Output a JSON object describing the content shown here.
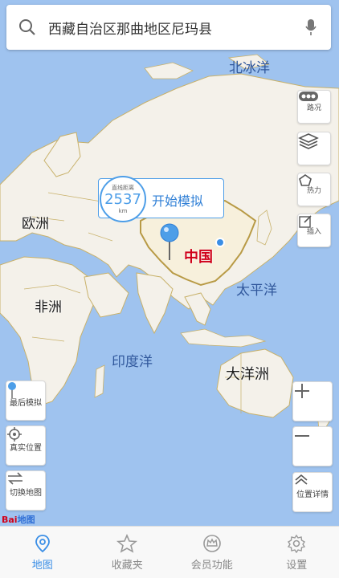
{
  "search": {
    "text": "西藏自治区那曲地区尼玛县"
  },
  "map": {
    "regions": {
      "europe": "欧洲",
      "africa": "非洲",
      "china": "中国",
      "oceania": "大洋洲"
    },
    "oceans": {
      "arctic": "北冰洋",
      "pacific": "太平洋",
      "indian": "印度洋"
    }
  },
  "bubble": {
    "distance_title": "直线距离",
    "distance_value": "2537",
    "distance_unit": "km",
    "simulate_label": "开始模拟"
  },
  "right_tools": {
    "traffic": "路况",
    "heat": "热力",
    "insert": "插入",
    "location_detail": "位置详情"
  },
  "left_tools": {
    "last_sim": "最后模拟",
    "real_location": "真实位置",
    "switch_map": "切换地图"
  },
  "logo": {
    "text": "Bai地图"
  },
  "tabs": [
    {
      "label": "地图",
      "active": true,
      "icon": "map-pin-icon"
    },
    {
      "label": "收藏夹",
      "active": false,
      "icon": "star-icon"
    },
    {
      "label": "会员功能",
      "active": false,
      "icon": "crown-icon"
    },
    {
      "label": "设置",
      "active": false,
      "icon": "gear-icon"
    }
  ],
  "colors": {
    "accent": "#3a8ee6",
    "sea": "#9fc3ef",
    "land": "#f4f1ea",
    "border": "#c8b16a",
    "china_label": "#d0021b"
  }
}
